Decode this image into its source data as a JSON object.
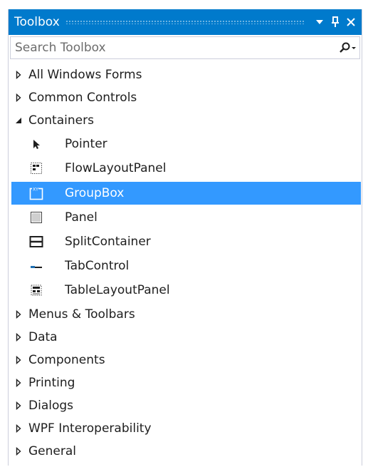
{
  "panel": {
    "title": "Toolbox",
    "buttons": {
      "dropdown_icon": "dropdown-arrow-icon",
      "pin_icon": "pin-icon",
      "close_icon": "close-icon"
    }
  },
  "search": {
    "placeholder": "Search Toolbox",
    "icon": "search-icon"
  },
  "colors": {
    "titlebar": "#007acc",
    "selection": "#3399ff",
    "text": "#1e1e1e"
  },
  "tree": {
    "groups_top": [
      {
        "label": "All Windows Forms",
        "expanded": false
      },
      {
        "label": "Common Controls",
        "expanded": false
      },
      {
        "label": "Containers",
        "expanded": true
      }
    ],
    "container_items": [
      {
        "label": "Pointer",
        "icon": "pointer-icon",
        "selected": false
      },
      {
        "label": "FlowLayoutPanel",
        "icon": "flowlayoutpanel-icon",
        "selected": false
      },
      {
        "label": "GroupBox",
        "icon": "groupbox-icon",
        "selected": true
      },
      {
        "label": "Panel",
        "icon": "panel-icon",
        "selected": false
      },
      {
        "label": "SplitContainer",
        "icon": "splitcontainer-icon",
        "selected": false
      },
      {
        "label": "TabControl",
        "icon": "tabcontrol-icon",
        "selected": false
      },
      {
        "label": "TableLayoutPanel",
        "icon": "tablelayoutpanel-icon",
        "selected": false
      }
    ],
    "groups_bottom": [
      {
        "label": "Menus & Toolbars",
        "expanded": false
      },
      {
        "label": "Data",
        "expanded": false
      },
      {
        "label": "Components",
        "expanded": false
      },
      {
        "label": "Printing",
        "expanded": false
      },
      {
        "label": "Dialogs",
        "expanded": false
      },
      {
        "label": "WPF Interoperability",
        "expanded": false
      },
      {
        "label": "General",
        "expanded": false
      }
    ]
  }
}
